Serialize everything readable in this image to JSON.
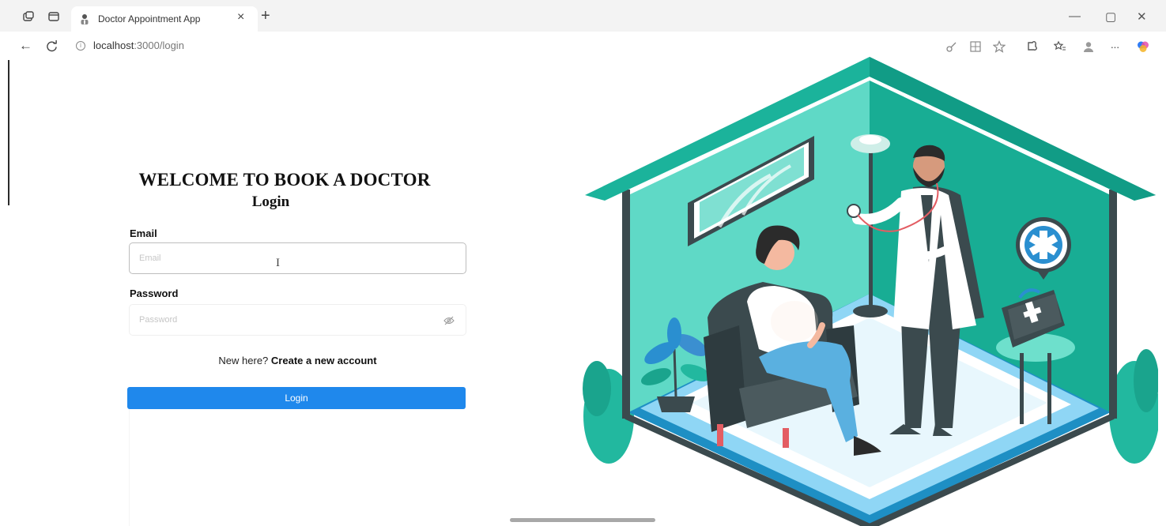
{
  "browser": {
    "tab_title": "Doctor Appointment App",
    "tab_close": "×",
    "new_tab": "+",
    "url_host": "localhost",
    "url_rest": ":3000/login",
    "window_controls": {
      "minimize": "—",
      "maximize": "▢",
      "close": "✕"
    },
    "nav": {
      "back": "←",
      "refresh": "C"
    },
    "toolbar_icons": [
      "key-icon",
      "grid-icon",
      "star-icon",
      "extension-icon",
      "favorites-icon",
      "profile-icon",
      "more-icon",
      "copilot-icon"
    ],
    "more_label": "···"
  },
  "login": {
    "heading": "WELCOME TO BOOK A DOCTOR",
    "subheading": "Login",
    "email_label": "Email",
    "email_placeholder": "Email",
    "email_value": "",
    "password_label": "Password",
    "password_placeholder": "Password",
    "password_value": "",
    "signup_prompt": "New here?",
    "signup_link": "Create a new account",
    "login_button": "Login"
  },
  "colors": {
    "primary_button": "#1f88ec",
    "house_teal": "#1bb39b",
    "house_dark_teal": "#119c86",
    "wall_light": "#5fd9c6",
    "floor_blue": "#8fd6f5"
  }
}
